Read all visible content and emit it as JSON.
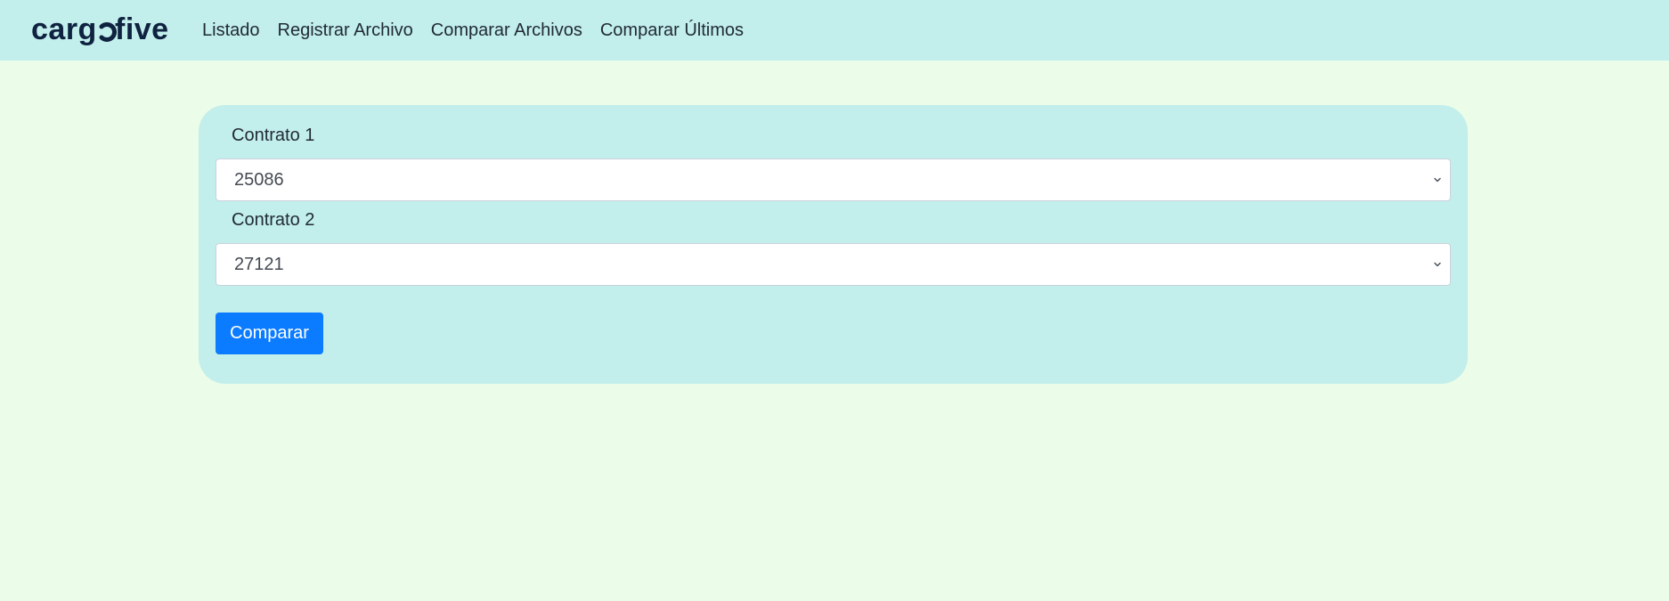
{
  "nav": {
    "logo_text": "cargofive",
    "links": [
      {
        "label": "Listado"
      },
      {
        "label": "Registrar Archivo"
      },
      {
        "label": "Comparar Archivos"
      },
      {
        "label": "Comparar Últimos"
      }
    ]
  },
  "form": {
    "contract1": {
      "label": "Contrato 1",
      "value": "25086"
    },
    "contract2": {
      "label": "Contrato 2",
      "value": "27121"
    },
    "submit_label": "Comparar"
  },
  "colors": {
    "page_bg": "#ebfce9",
    "navbar_bg": "#c2eeeb",
    "card_bg": "#c2eeeb",
    "logo": "#0f2240",
    "button": "#0b7bff",
    "text": "#212b36"
  }
}
